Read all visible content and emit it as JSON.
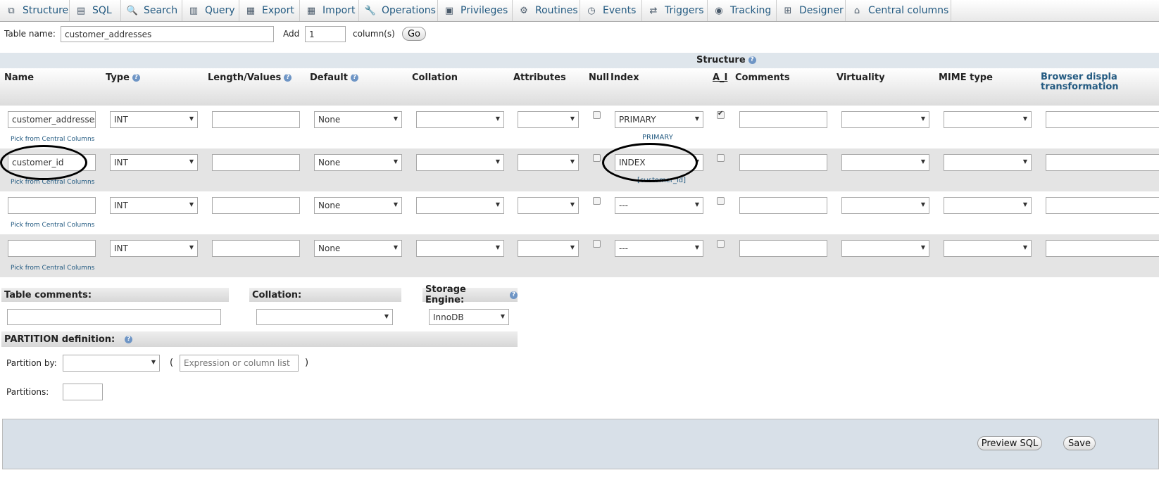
{
  "tabs": [
    {
      "label": "Structure",
      "icon": "structure-icon",
      "glyph": "⧉"
    },
    {
      "label": "SQL",
      "icon": "sql-icon",
      "glyph": "▤"
    },
    {
      "label": "Search",
      "icon": "search-icon",
      "glyph": "🔍"
    },
    {
      "label": "Query",
      "icon": "query-icon",
      "glyph": "▥"
    },
    {
      "label": "Export",
      "icon": "export-icon",
      "glyph": "▦"
    },
    {
      "label": "Import",
      "icon": "import-icon",
      "glyph": "▦"
    },
    {
      "label": "Operations",
      "icon": "operations-icon",
      "glyph": "🔧"
    },
    {
      "label": "Privileges",
      "icon": "privileges-icon",
      "glyph": "▣"
    },
    {
      "label": "Routines",
      "icon": "routines-icon",
      "glyph": "⚙"
    },
    {
      "label": "Events",
      "icon": "events-icon",
      "glyph": "◷"
    },
    {
      "label": "Triggers",
      "icon": "triggers-icon",
      "glyph": "⇄"
    },
    {
      "label": "Tracking",
      "icon": "tracking-icon",
      "glyph": "◉"
    },
    {
      "label": "Designer",
      "icon": "designer-icon",
      "glyph": "⊞"
    },
    {
      "label": "Central columns",
      "icon": "central-columns-icon",
      "glyph": "⌂"
    }
  ],
  "table_name_label": "Table name:",
  "table_name_value": "customer_addresses",
  "add_label": "Add",
  "add_value": "1",
  "columns_label": "column(s)",
  "go_label": "Go",
  "structure_label": "Structure",
  "headers": {
    "name": "Name",
    "type": "Type",
    "length": "Length/Values",
    "default": "Default",
    "collation": "Collation",
    "attributes": "Attributes",
    "null": "Null",
    "index": "Index",
    "ai": "A_I",
    "comments": "Comments",
    "virtuality": "Virtuality",
    "mime": "MIME type",
    "browser_line1": "Browser displa",
    "browser_line2": "transformation"
  },
  "pick_label": "Pick from Central Columns",
  "rows": [
    {
      "name": "customer_addresses",
      "type": "INT",
      "length": "",
      "default": "None",
      "collation": "",
      "attributes": "",
      "null": false,
      "index": "PRIMARY",
      "index_note": "PRIMARY",
      "ai": true
    },
    {
      "name": "customer_id",
      "type": "INT",
      "length": "",
      "default": "None",
      "collation": "",
      "attributes": "",
      "null": false,
      "index": "INDEX",
      "index_note": "[customer_id]",
      "ai": false
    },
    {
      "name": "",
      "type": "INT",
      "length": "",
      "default": "None",
      "collation": "",
      "attributes": "",
      "null": false,
      "index": "---",
      "index_note": "",
      "ai": false
    },
    {
      "name": "",
      "type": "INT",
      "length": "",
      "default": "None",
      "collation": "",
      "attributes": "",
      "null": false,
      "index": "---",
      "index_note": "",
      "ai": false
    }
  ],
  "table_comments_label": "Table comments:",
  "collation_label": "Collation:",
  "storage_engine_label": "Storage Engine:",
  "storage_engine_value": "InnoDB",
  "partition_def_label": "PARTITION definition:",
  "partition_by_label": "Partition by:",
  "partition_expr_placeholder": "Expression or column list",
  "open_paren": "(",
  "close_paren": ")",
  "partitions_label": "Partitions:",
  "preview_sql_label": "Preview SQL",
  "save_label": "Save",
  "help_glyph": "?"
}
